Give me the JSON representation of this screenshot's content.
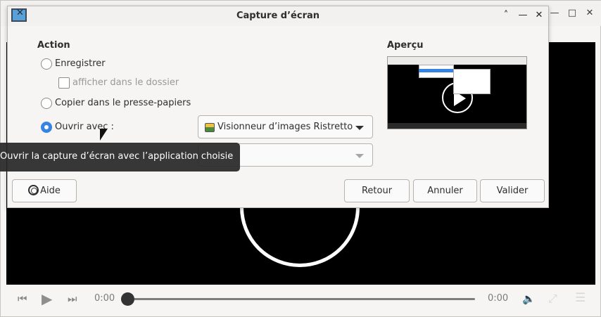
{
  "dialog": {
    "title": "Capture d’écran",
    "action_heading": "Action",
    "preview_heading": "Aperçu",
    "options": {
      "save_label": "Enregistrer",
      "show_in_folder_label": "afficher dans le dossier",
      "copy_label": "Copier dans le presse-papiers",
      "open_with_label": "Ouvrir avec :"
    },
    "selected_option": "Ouvrir avec :",
    "app_combo": {
      "value": "Visionneur d’images Ristretto",
      "icon": "ristretto-app-icon"
    },
    "second_combo": {
      "value": ""
    },
    "buttons": {
      "help": "Aide",
      "back": "Retour",
      "cancel": "Annuler",
      "validate": "Valider"
    }
  },
  "tooltip": {
    "text": "Ouvrir la capture d’écran avec l’application choisie"
  },
  "player": {
    "time_current": "0:00",
    "time_total": "0:00",
    "progress": 0
  },
  "colors": {
    "accent": "#3584e4",
    "tooltip_bg": "#282828",
    "video_bg": "#000000"
  }
}
